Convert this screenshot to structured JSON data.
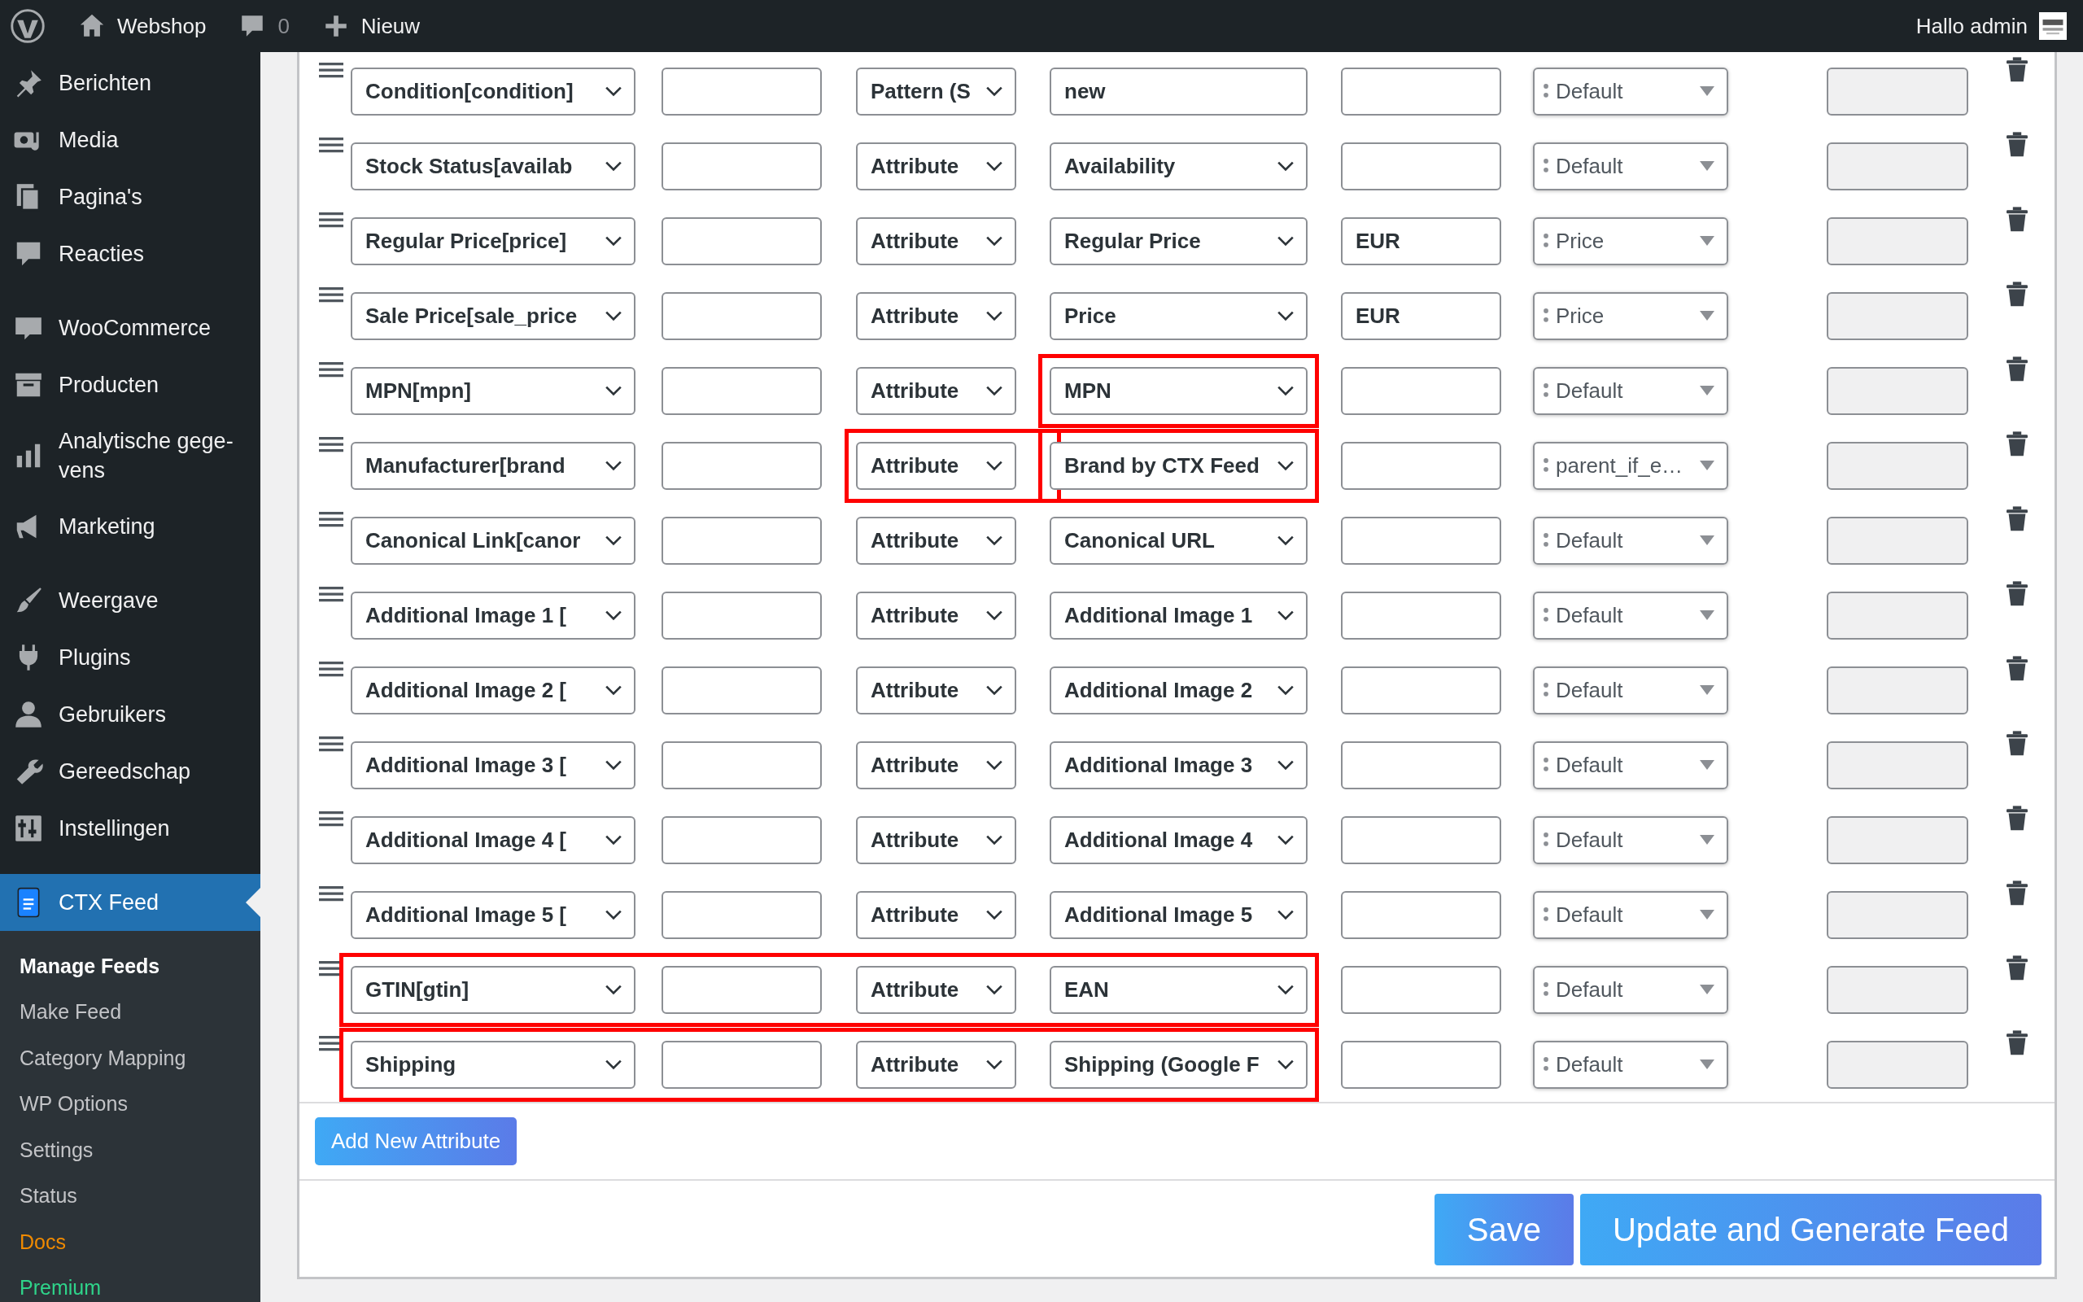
{
  "admin_bar": {
    "site": "Webshop",
    "comments": "0",
    "new": "Nieuw",
    "greeting": "Hallo admin"
  },
  "sidebar": {
    "groups": [
      {
        "items": [
          {
            "label": "Berichten",
            "selected": false
          },
          {
            "label": "Media",
            "selected": false
          },
          {
            "label": "Pagina's",
            "selected": false
          },
          {
            "label": "Reacties",
            "selected": false
          }
        ]
      },
      {
        "items": [
          {
            "label": "WooCommerce",
            "selected": false
          },
          {
            "label": "Producten",
            "selected": false
          },
          {
            "label": "Analytische gege-vens",
            "selected": false
          },
          {
            "label": "Marketing",
            "selected": false
          }
        ]
      },
      {
        "items": [
          {
            "label": "Weergave",
            "selected": false
          },
          {
            "label": "Plugins",
            "selected": false
          },
          {
            "label": "Gebruikers",
            "selected": false
          },
          {
            "label": "Gereedschap",
            "selected": false
          },
          {
            "label": "Instellingen",
            "selected": false
          }
        ]
      },
      {
        "items": [
          {
            "label": "CTX Feed",
            "selected": true
          }
        ]
      }
    ],
    "submenu": [
      {
        "label": "Manage Feeds",
        "selected": true
      },
      {
        "label": "Make Feed",
        "selected": false
      },
      {
        "label": "Category Mapping",
        "selected": false
      },
      {
        "label": "WP Options",
        "selected": false
      },
      {
        "label": "Settings",
        "selected": false
      },
      {
        "label": "Status",
        "selected": false
      },
      {
        "label": "Docs",
        "selected": false,
        "color": "#f08a00"
      },
      {
        "label": "Premium",
        "selected": false,
        "color": "#2fd48a"
      }
    ]
  },
  "rows": [
    {
      "field": "Condition[condition]",
      "type": "Pattern (S",
      "value": "new",
      "kind": "text",
      "output": "Default",
      "row_highlighted": false,
      "type_highlighted": false,
      "value_highlighted": false
    },
    {
      "field": "Stock Status[availab",
      "type": "Attribute",
      "value": "Availability",
      "kind": "select",
      "output": "Default",
      "row_highlighted": false,
      "type_highlighted": false,
      "value_highlighted": false
    },
    {
      "field": "Regular Price[price]",
      "type": "Attribute",
      "value": "Regular Price",
      "kind": "select",
      "prefix": "EUR",
      "output": "Price",
      "row_highlighted": false,
      "type_highlighted": false,
      "value_highlighted": false
    },
    {
      "field": "Sale Price[sale_price",
      "type": "Attribute",
      "value": "Price",
      "kind": "select",
      "prefix": "EUR",
      "output": "Price",
      "row_highlighted": false,
      "type_highlighted": false,
      "value_highlighted": false
    },
    {
      "field": "MPN[mpn]",
      "type": "Attribute",
      "value": "MPN",
      "kind": "select",
      "output": "Default",
      "row_highlighted": false,
      "type_highlighted": false,
      "value_highlighted": true
    },
    {
      "field": "Manufacturer[brand",
      "type": "Attribute",
      "value": "Brand by CTX Feed",
      "kind": "select",
      "output": "parent_if_e…",
      "row_highlighted": false,
      "type_highlighted": true,
      "value_highlighted": true
    },
    {
      "field": "Canonical Link[canor",
      "type": "Attribute",
      "value": "Canonical URL",
      "kind": "select",
      "output": "Default",
      "row_highlighted": false,
      "type_highlighted": false,
      "value_highlighted": false
    },
    {
      "field": "Additional Image 1 [",
      "type": "Attribute",
      "value": "Additional Image 1",
      "kind": "select",
      "output": "Default",
      "row_highlighted": false,
      "type_highlighted": false,
      "value_highlighted": false
    },
    {
      "field": "Additional Image 2 [",
      "type": "Attribute",
      "value": "Additional Image 2",
      "kind": "select",
      "output": "Default",
      "row_highlighted": false,
      "type_highlighted": false,
      "value_highlighted": false
    },
    {
      "field": "Additional Image 3 [",
      "type": "Attribute",
      "value": "Additional Image 3",
      "kind": "select",
      "output": "Default",
      "row_highlighted": false,
      "type_highlighted": false,
      "value_highlighted": false
    },
    {
      "field": "Additional Image 4 [",
      "type": "Attribute",
      "value": "Additional Image 4",
      "kind": "select",
      "output": "Default",
      "row_highlighted": false,
      "type_highlighted": false,
      "value_highlighted": false
    },
    {
      "field": "Additional Image 5 [",
      "type": "Attribute",
      "value": "Additional Image 5",
      "kind": "select",
      "output": "Default",
      "row_highlighted": false,
      "type_highlighted": false,
      "value_highlighted": false
    },
    {
      "field": "GTIN[gtin]",
      "type": "Attribute",
      "value": "EAN",
      "kind": "select",
      "output": "Default",
      "row_highlighted": true,
      "type_highlighted": false,
      "value_highlighted": false
    },
    {
      "field": "Shipping",
      "type": "Attribute",
      "value": "Shipping (Google F",
      "kind": "select",
      "output": "Default",
      "row_highlighted": true,
      "type_highlighted": false,
      "value_highlighted": false
    }
  ],
  "add_button": "Add New Attribute",
  "buttons": [
    "Save",
    "Update and Generate Feed"
  ]
}
